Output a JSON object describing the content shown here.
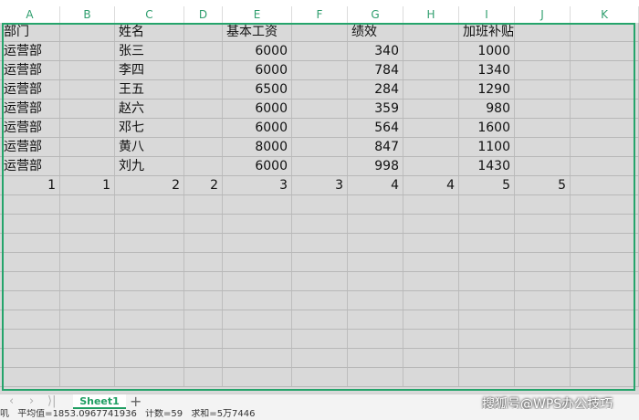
{
  "column_headers": [
    "A",
    "B",
    "C",
    "D",
    "E",
    "F",
    "G",
    "H",
    "I",
    "J",
    "K"
  ],
  "rows": [
    [
      "部门",
      "",
      "姓名",
      "",
      "基本工资",
      "",
      "绩效",
      "",
      "加班补贴",
      "",
      ""
    ],
    [
      "运营部",
      "",
      "张三",
      "",
      "6000",
      "",
      "340",
      "",
      "1000",
      "",
      ""
    ],
    [
      "运营部",
      "",
      "李四",
      "",
      "6000",
      "",
      "784",
      "",
      "1340",
      "",
      ""
    ],
    [
      "运营部",
      "",
      "王五",
      "",
      "6500",
      "",
      "284",
      "",
      "1290",
      "",
      ""
    ],
    [
      "运营部",
      "",
      "赵六",
      "",
      "6000",
      "",
      "359",
      "",
      "980",
      "",
      ""
    ],
    [
      "运营部",
      "",
      "邓七",
      "",
      "6000",
      "",
      "564",
      "",
      "1600",
      "",
      ""
    ],
    [
      "运营部",
      "",
      "黄八",
      "",
      "8000",
      "",
      "847",
      "",
      "1100",
      "",
      ""
    ],
    [
      "运营部",
      "",
      "刘九",
      "",
      "6000",
      "",
      "998",
      "",
      "1430",
      "",
      ""
    ],
    [
      "1",
      "1",
      "2",
      "2",
      "3",
      "3",
      "4",
      "4",
      "5",
      "5",
      ""
    ]
  ],
  "numeric_columns": [
    4,
    6,
    8
  ],
  "empty_row_count": 10,
  "sheet_tabs": [
    "Sheet1"
  ],
  "add_sheet_label": "+",
  "nav_buttons": [
    "‹",
    "›",
    "⟩|"
  ],
  "status": {
    "left_glyph": "叽",
    "average": "平均值=1853.0967741936",
    "count": "计数=59",
    "sum": "求和=5万7446"
  },
  "watermark": "搜狐号@WPS办公技巧",
  "colors": {
    "accent": "#25a46b",
    "cell_background": "#d9d9d9",
    "header_text": "#2f9e6e"
  }
}
